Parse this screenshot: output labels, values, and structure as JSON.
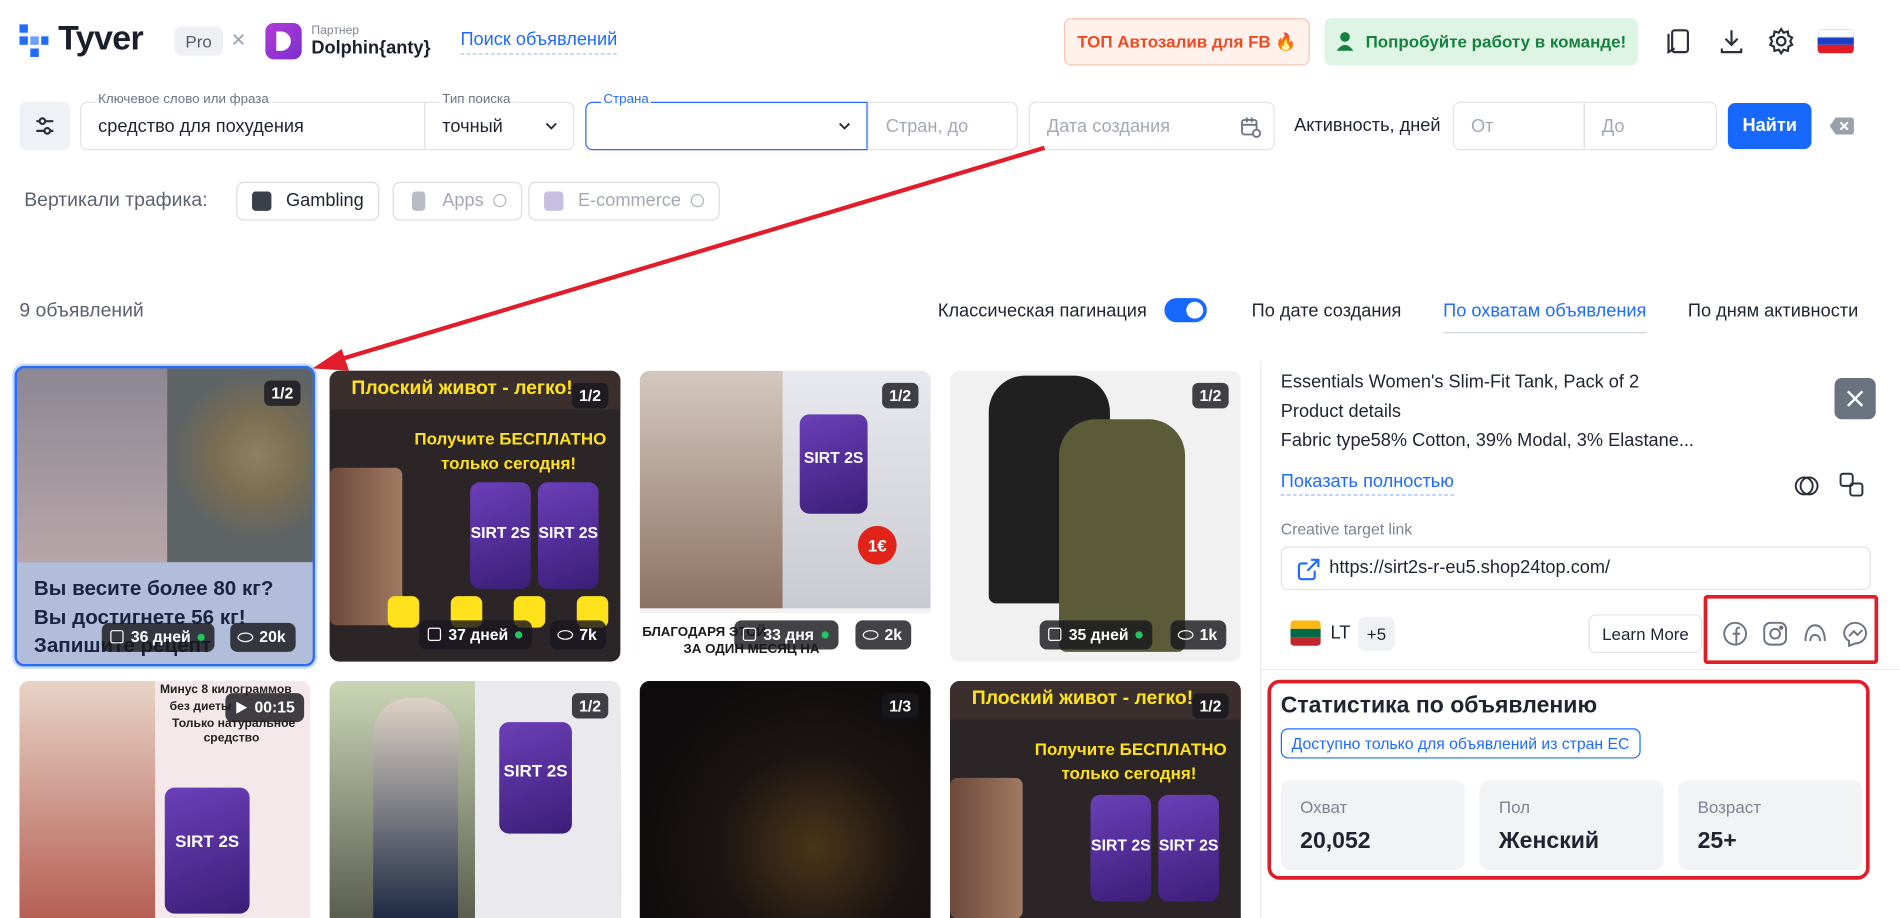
{
  "header": {
    "logo": "Tyver",
    "plan_badge": "Pro",
    "separator": "×",
    "partner_caption": "Партнер",
    "partner_name": "Dolphin{anty}",
    "nav_link": "Поиск объявлений",
    "promo_button": "ТОП Автозалив для FB 🔥",
    "team_button": "Попробуйте работу в команде!",
    "icons": [
      "bookmark-icon",
      "download-icon",
      "settings-icon"
    ],
    "language": "ru"
  },
  "filters": {
    "keyword_label": "Ключевое слово или фраза",
    "keyword_value": "средство для похудения",
    "search_type_label": "Тип поиска",
    "search_type_value": "точный",
    "country_label": "Страна",
    "country_value": "",
    "countries_to_placeholder": "Стран, до",
    "created_placeholder": "Дата создания",
    "activity_label": "Активность, дней",
    "from_placeholder": "От",
    "to_placeholder": "До",
    "find_button": "Найти"
  },
  "verticals": {
    "label": "Вертикали трафика:",
    "items": [
      "Gambling",
      "Apps",
      "E-commerce"
    ]
  },
  "results": {
    "count_text": "9 объявлений",
    "pagination_label": "Классическая пагинация",
    "pagination_on": true,
    "sort_options": [
      "По дате создания",
      "По охватам объявления",
      "По дням активности"
    ],
    "active_sort": "По охватам объявления"
  },
  "cards": [
    {
      "ratio": "1/2",
      "days": "36 дней",
      "views": "20k",
      "texts": [
        "Вы весите более 80 кг?",
        "Вы достигнете 56 кг!",
        "Запишите рецепт"
      ]
    },
    {
      "ratio": "1/2",
      "days": "37 дней",
      "views": "7k",
      "texts": [
        "Плоский живот - легко!",
        "Получите БЕСПЛАТНО",
        "только сегодня!",
        "SIRT 2S"
      ]
    },
    {
      "ratio": "1/2",
      "days": "33 дня",
      "views": "2k",
      "texts": [
        "1€",
        "БЛАГОДАРЯ ЭТОЙ",
        "ЗА ОДИН МЕСЯЦ НА",
        "SIRT 2S"
      ]
    },
    {
      "ratio": "1/2",
      "days": "35 дней",
      "views": "1k",
      "texts": []
    },
    {
      "ratio": "",
      "duration": "00:15",
      "texts": [
        "Минус 8 килограммов",
        "без диеты",
        "Только натуральное",
        "средство",
        "SIRT 2S"
      ]
    },
    {
      "ratio": "1/2",
      "texts": [
        "SIRT 2S"
      ]
    },
    {
      "ratio": "1/3",
      "texts": []
    },
    {
      "ratio": "1/2",
      "texts": [
        "Плоский живот - легко!",
        "Получите БЕСПЛАТНО",
        "только сегодня!",
        "SIRT 2S"
      ]
    }
  ],
  "detail": {
    "title": "Essentials Women's Slim-Fit Tank, Pack of 2",
    "subtitle": "Product details",
    "description": "Fabric type58% Cotton, 39% Modal, 3% Elastane...",
    "show_full": "Показать полностью",
    "target_label": "Creative target link",
    "target_url": "https://sirt2s-r-eu5.shop24top.com/",
    "country_code": "LT",
    "more_countries": "+5",
    "cta": "Learn More",
    "platforms": [
      "facebook-icon",
      "instagram-icon",
      "audience-network-icon",
      "messenger-icon"
    ]
  },
  "stats": {
    "title": "Статистика по объявлению",
    "eu_badge": "Доступно только для объявлений из стран ЕС",
    "items": [
      {
        "label": "Охват",
        "value": "20,052"
      },
      {
        "label": "Пол",
        "value": "Женский"
      },
      {
        "label": "Возраст",
        "value": "25+"
      }
    ]
  },
  "colors": {
    "accent": "#1668ff",
    "annotation_red": "#e11d2a",
    "promo": "#ef4a22",
    "team": "#17803d"
  }
}
